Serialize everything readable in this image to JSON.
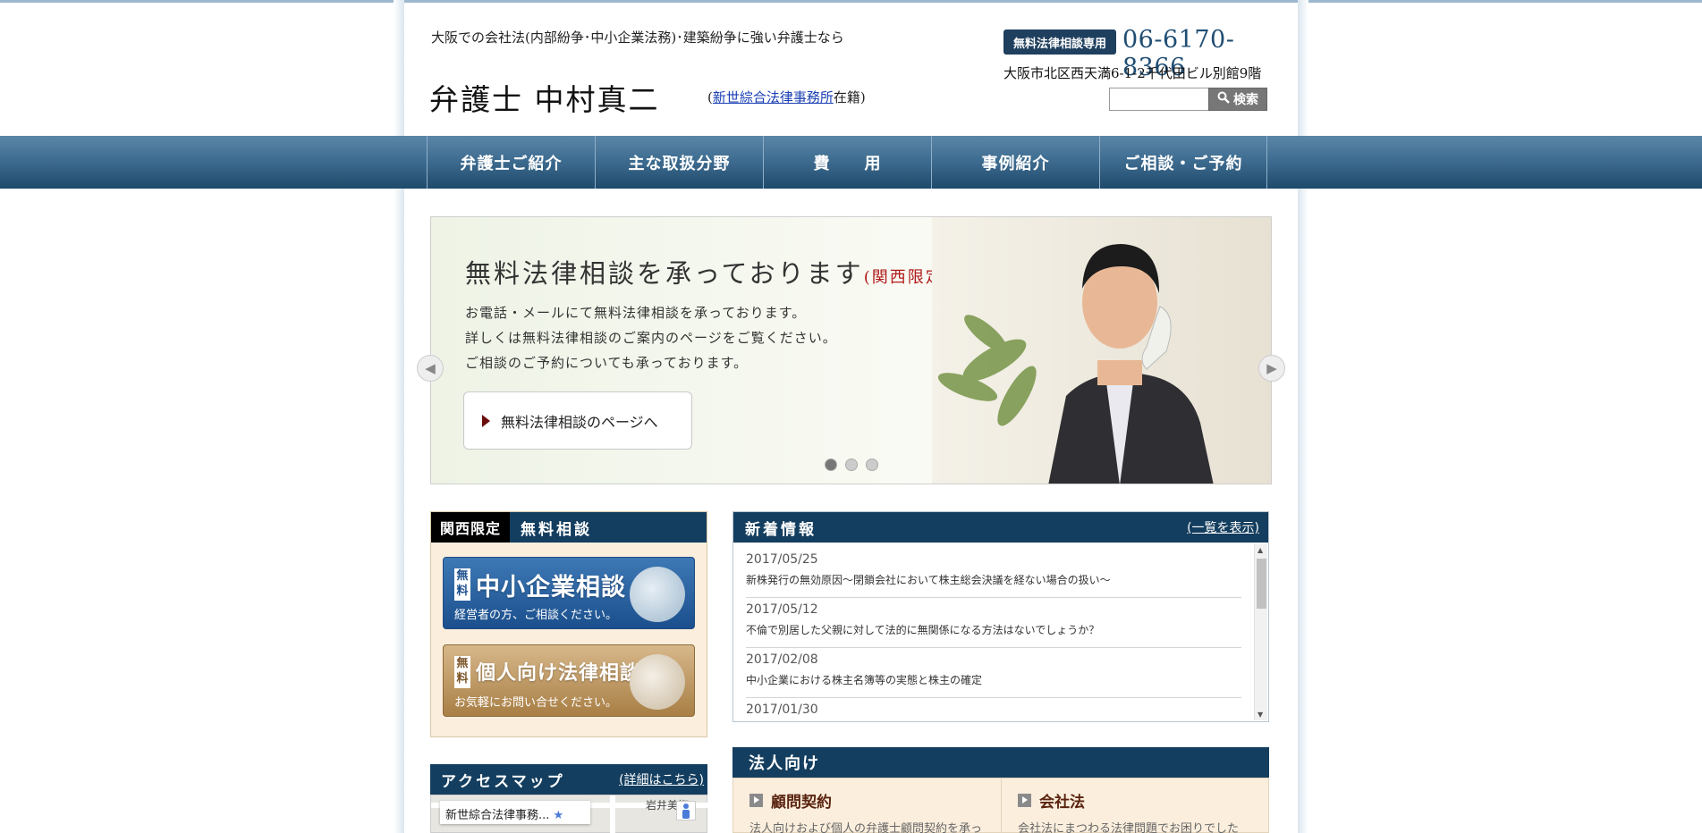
{
  "header": {
    "tagline": "大阪での会社法(内部紛争･中小企業法務)･建築紛争に強い弁護士なら",
    "lawyer_name": "弁護士 中村真二",
    "firm_prefix": "(",
    "firm_link": "新世綜合法律事務所",
    "firm_suffix": "在籍)",
    "tel_badge": "無料法律相談専用",
    "tel_number": "06-6170-8366",
    "address": "大阪市北区西天満6-1-2千代田ビル別館9階",
    "search_placeholder": "",
    "search_label": "検索",
    "search_icon": "magnifier-icon"
  },
  "nav": {
    "items": [
      "弁護士ご紹介",
      "主な取扱分野",
      "費　　用",
      "事例紹介",
      "ご相談・ご予約"
    ]
  },
  "hero": {
    "title": "無料法律相談を承っております",
    "region": "(関西限定)",
    "lines": [
      "お電話・メールにて無料法律相談を承っております。",
      "詳しくは無料法律相談のご案内のページをご覧ください。",
      "ご相談のご予約についても承っております。"
    ],
    "button_label": "無料法律相談のページへ",
    "slide_count": 3,
    "active_slide": 1
  },
  "free_consult": {
    "tag": "関西限定",
    "title": "無料相談",
    "banners": [
      {
        "free": "無料",
        "title": "中小企業相談",
        "sub": "経営者の方、ご相談ください。"
      },
      {
        "free": "無料",
        "title": "個人向け法律相談",
        "sub": "お気軽にお問い合せください。"
      }
    ]
  },
  "access": {
    "title": "アクセスマップ",
    "link": "(詳細はこちら)",
    "map_label": "新世綜合法律事務...",
    "map_place": "岩井美術"
  },
  "news": {
    "title": "新着情報",
    "link": "(一覧を表示)",
    "items": [
      {
        "date": "2017/05/25",
        "title": "新株発行の無効原因～閉鎖会社において株主総会決議を経ない場合の扱い～"
      },
      {
        "date": "2017/05/12",
        "title": "不倫で別居した父親に対して法的に無関係になる方法はないでしょうか？"
      },
      {
        "date": "2017/02/08",
        "title": "中小企業における株主名簿等の実態と株主の確定"
      },
      {
        "date": "2017/01/30",
        "title": ""
      }
    ]
  },
  "corporate": {
    "title": "法人向け",
    "columns": [
      {
        "heading": "顧問契約",
        "desc": "法人向けおよび個人の弁護士顧問契約を承っ"
      },
      {
        "heading": "会社法",
        "desc": "会社法にまつわる法律問題でお困りでした"
      }
    ]
  },
  "colors": {
    "nav_dark": "#1e4a6b",
    "panel_head": "#143e5f",
    "accent_red": "#b01a1a",
    "panel_bg": "#fbeedd"
  }
}
